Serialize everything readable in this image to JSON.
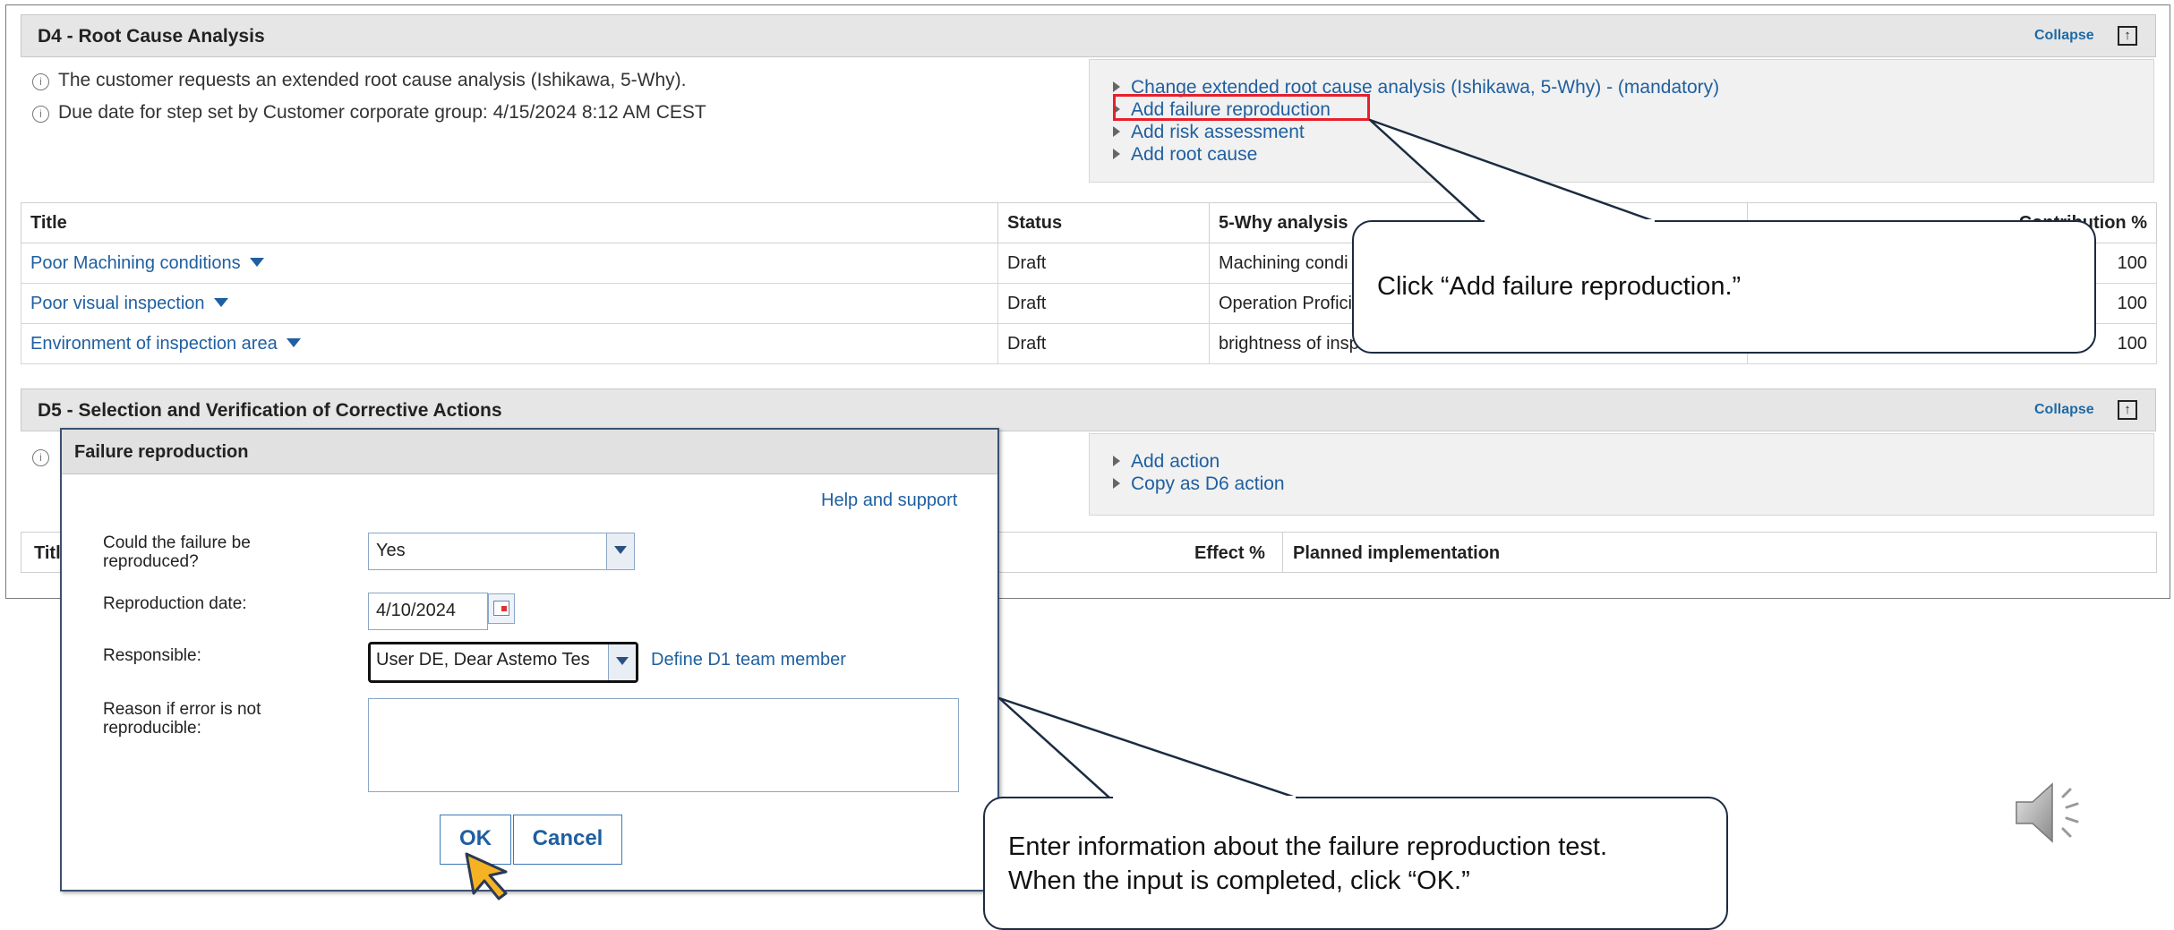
{
  "d4": {
    "title": "D4 - Root Cause Analysis",
    "collapse": "Collapse",
    "info": [
      "The customer requests an extended root cause analysis (Ishikawa, 5-Why).",
      "Due date for step set by Customer corporate group: 4/15/2024 8:12 AM CEST"
    ],
    "actions": [
      "Change extended root cause analysis (Ishikawa, 5-Why) - (mandatory)",
      "Add failure reproduction",
      "Add risk assessment",
      "Add root cause"
    ],
    "table": {
      "headers": [
        "Title",
        "Status",
        "5-Why analysis",
        "Contribution %"
      ],
      "rows": [
        {
          "title": "Poor Machining conditions",
          "status": "Draft",
          "why": "Machining condi",
          "contribution": "100"
        },
        {
          "title": "Poor visual inspection",
          "status": "Draft",
          "why": "Operation Profici",
          "contribution": "100"
        },
        {
          "title": "Environment of inspection area",
          "status": "Draft",
          "why": "brightness of insp",
          "contribution": "100"
        }
      ]
    }
  },
  "d5": {
    "title": "D5 - Selection and Verification of Corrective Actions",
    "collapse": "Collapse",
    "actions": [
      "Add action",
      "Copy as D6 action"
    ],
    "table_headers": {
      "title": "Titl",
      "effect": "Effect %",
      "planned": "Planned implementation"
    }
  },
  "dialog": {
    "title": "Failure reproduction",
    "help": "Help and support",
    "fields": {
      "reproduced_label": "Could the failure be reproduced?",
      "reproduced_value": "Yes",
      "date_label": "Reproduction date:",
      "date_value": "4/10/2024",
      "responsible_label": "Responsible:",
      "responsible_value": "User DE, Dear Astemo Tes",
      "define_link": "Define D1 team member",
      "reason_label": "Reason if error is not reproducible:",
      "reason_value": ""
    },
    "ok": "OK",
    "cancel": "Cancel"
  },
  "callouts": {
    "top": "Click “Add failure reproduction.”",
    "bottom_line1": "Enter information about the failure reproduction test.",
    "bottom_line2": "When the input is completed, click “OK.”"
  },
  "colors": {
    "link": "#1f5fa0",
    "highlight": "#e8202a",
    "cursor": "#f5b324",
    "header_bg": "#e6e6e6"
  },
  "icons": [
    "info-icon",
    "calendar-icon",
    "speaker-icon",
    "cursor-arrow-icon",
    "collapse-icon"
  ]
}
